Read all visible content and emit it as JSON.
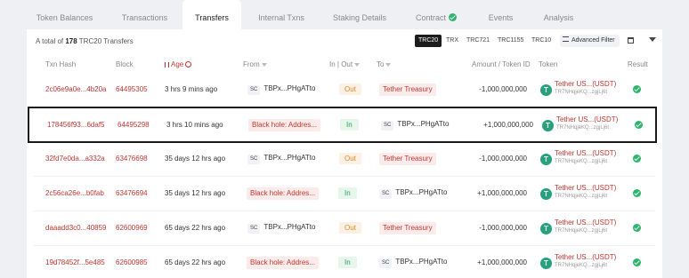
{
  "tabs": [
    {
      "label": "Token Balances"
    },
    {
      "label": "Transactions"
    },
    {
      "label": "Transfers"
    },
    {
      "label": "Internal Txns"
    },
    {
      "label": "Staking Details"
    },
    {
      "label": "Contract"
    },
    {
      "label": "Events"
    },
    {
      "label": "Analysis"
    }
  ],
  "summary": {
    "prefix": "A total of ",
    "count": "178",
    "suffix": " TRC20 Transfers"
  },
  "token_types": [
    "TRC20",
    "TRX",
    "TRC721",
    "TRC1155",
    "TRC10"
  ],
  "advanced_filter": "Advanced Filter",
  "columns": {
    "hash": "Txn Hash",
    "block": "Block",
    "age": "Age",
    "from": "From",
    "inout": "In | Out",
    "to": "To",
    "amount": "Amount / Token ID",
    "token": "Token",
    "result": "Result"
  },
  "rows": [
    {
      "hash": "2c06e9a0e...4b20a",
      "block": "64495305",
      "age": "3 hrs 9 mins ago",
      "from_sc": "SC",
      "from": "TBPx...PHgATto",
      "dir": "Out",
      "to": "Tether Treasury",
      "amount": "-1,000,000,000",
      "token": "Tether US...(USDT)",
      "token_addr": "TR7NHqjeKQ...zgjLj6t"
    },
    {
      "hash": "178456f93...6daf5",
      "block": "64495298",
      "age": "3 hrs 10 mins ago",
      "from": "Black hole: Addres...",
      "dir": "In",
      "to_sc": "SC",
      "to": "TBPx...PHgATto",
      "amount": "+1,000,000,000",
      "token": "Tether US...(USDT)",
      "token_addr": "TR7NHqjeKQ...zgjLj6t"
    },
    {
      "hash": "32fd7e0da...a332a",
      "block": "63476698",
      "age": "35 days 12 hrs ago",
      "from_sc": "SC",
      "from": "TBPx...PHgATto",
      "dir": "Out",
      "to": "Tether Treasury",
      "amount": "-1,000,000,000",
      "token": "Tether US...(USDT)",
      "token_addr": "TR7NHqjeKQ...zgjLj6t"
    },
    {
      "hash": "2c56ca26e...b0fab",
      "block": "63476694",
      "age": "35 days 12 hrs ago",
      "from": "Black hole: Addres...",
      "dir": "In",
      "to_sc": "SC",
      "to": "TBPx...PHgATto",
      "amount": "+1,000,000,000",
      "token": "Tether US...(USDT)",
      "token_addr": "TR7NHqjeKQ...zgjLj6t"
    },
    {
      "hash": "daaadd3c0...40859",
      "block": "62600969",
      "age": "65 days 22 hrs ago",
      "from_sc": "SC",
      "from": "TBPx...PHgATto",
      "dir": "Out",
      "to": "Tether Treasury",
      "amount": "-1,000,000,000",
      "token": "Tether US...(USDT)",
      "token_addr": "TR7NHqjeKQ...zgjLj6t"
    },
    {
      "hash": "19d78452f...5e485",
      "block": "62600985",
      "age": "65 days 22 hrs ago",
      "from": "Black hole: Addres...",
      "dir": "In",
      "to_sc": "SC",
      "to": "TBPx...PHgATto",
      "amount": "+1,000,000,000",
      "token": "Tether US...(USDT)",
      "token_addr": "TR7NHqjeKQ...zgjLj6t"
    }
  ],
  "highlighted_row": 1,
  "colors": {
    "accent": "#c23631",
    "success": "#2cb66b",
    "tether": "#26a17b"
  }
}
